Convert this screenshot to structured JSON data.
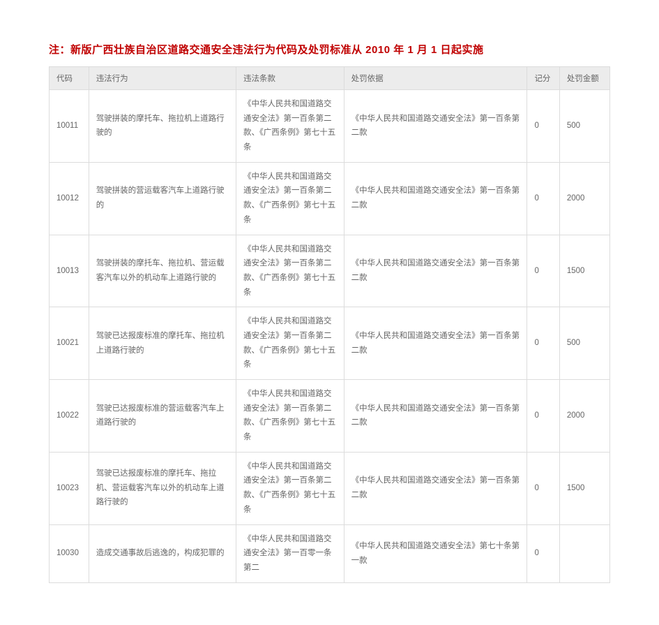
{
  "title": "注：新版广西壮族自治区道路交通安全违法行为代码及处罚标准从 2010 年 1 月 1 日起实施",
  "columns": {
    "code": "代码",
    "behavior": "违法行为",
    "clause": "违法条款",
    "basis": "处罚依据",
    "score": "记分",
    "fine": "处罚金额"
  },
  "rows": [
    {
      "code": "10011",
      "behavior": "驾驶拼装的摩托车、拖拉机上道路行驶的",
      "clause": "《中华人民共和国道路交通安全法》第一百条第二款、《广西条例》第七十五条",
      "basis": "《中华人民共和国道路交通安全法》第一百条第二款",
      "score": "0",
      "fine": "500"
    },
    {
      "code": "10012",
      "behavior": "驾驶拼装的营运载客汽车上道路行驶的",
      "clause": "《中华人民共和国道路交通安全法》第一百条第二款、《广西条例》第七十五条",
      "basis": "《中华人民共和国道路交通安全法》第一百条第二款",
      "score": "0",
      "fine": "2000"
    },
    {
      "code": "10013",
      "behavior": "驾驶拼装的摩托车、拖拉机、营运载客汽车以外的机动车上道路行驶的",
      "clause": "《中华人民共和国道路交通安全法》第一百条第二款、《广西条例》第七十五条",
      "basis": "《中华人民共和国道路交通安全法》第一百条第二款",
      "score": "0",
      "fine": "1500"
    },
    {
      "code": "10021",
      "behavior": "驾驶已达报废标准的摩托车、拖拉机上道路行驶的",
      "clause": "《中华人民共和国道路交通安全法》第一百条第二款、《广西条例》第七十五条",
      "basis": "《中华人民共和国道路交通安全法》第一百条第二款",
      "score": "0",
      "fine": "500"
    },
    {
      "code": "10022",
      "behavior": "驾驶已达报废标准的营运载客汽车上道路行驶的",
      "clause": "《中华人民共和国道路交通安全法》第一百条第二款、《广西条例》第七十五条",
      "basis": "《中华人民共和国道路交通安全法》第一百条第二款",
      "score": "0",
      "fine": "2000"
    },
    {
      "code": "10023",
      "behavior": "驾驶已达报废标准的摩托车、拖拉机、营运载客汽车以外的机动车上道路行驶的",
      "clause": "《中华人民共和国道路交通安全法》第一百条第二款、《广西条例》第七十五条",
      "basis": "《中华人民共和国道路交通安全法》第一百条第二款",
      "score": "0",
      "fine": "1500"
    },
    {
      "code": "10030",
      "behavior": "造成交通事故后逃逸的，构成犯罪的",
      "clause": "《中华人民共和国道路交通安全法》第一百零一条第二",
      "basis": "《中华人民共和国道路交通安全法》第七十条第一款",
      "score": "0",
      "fine": ""
    }
  ]
}
